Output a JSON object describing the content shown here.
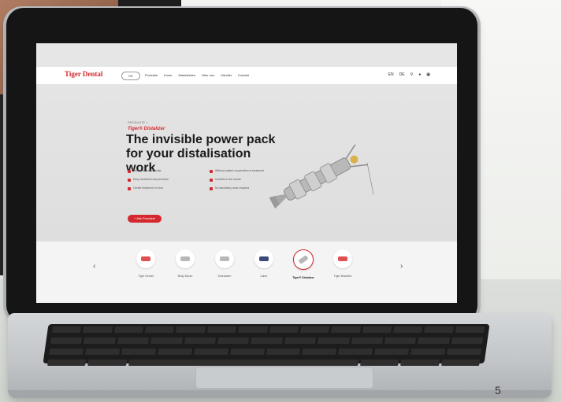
{
  "site": {
    "logo": "Tiger Dental",
    "nav_pill": "DE",
    "nav_links": [
      "Produkte",
      "Kurse",
      "Marktstellen",
      "Über uns",
      "Händler",
      "Kontakt"
    ],
    "nav_right": [
      "EN",
      "DE"
    ],
    "breadcrumb": "PRODUKTE >",
    "brand": "Tiger® Distalizer",
    "headline": "The invisible power pack for your distalisation work",
    "bullets": [
      "Easy insertion of molar",
      "Without patient cooperation in treatment",
      "Easy treatment and precision",
      "Invisible in the mouth",
      "Gentle treatment in front",
      "No laboratory work required"
    ],
    "cta_label": "+ Alle Produkte",
    "carousel": {
      "prev_icon": "chevron-left-icon",
      "next_icon": "chevron-right-icon",
      "items": [
        {
          "label": "Tiger Dental",
          "active": false
        },
        {
          "label": "Body Mount",
          "active": false
        },
        {
          "label": "Schrauben",
          "active": false
        },
        {
          "label": "Labor",
          "active": false
        },
        {
          "label": "Tiger® Distalizer",
          "active": true
        },
        {
          "label": "Tiger Brackets",
          "active": false
        }
      ]
    }
  },
  "photo_caption_number": "5",
  "colors": {
    "brand_red": "#d3282e",
    "screen_bezel": "#151515",
    "aluminium": "#c3c6c9"
  }
}
